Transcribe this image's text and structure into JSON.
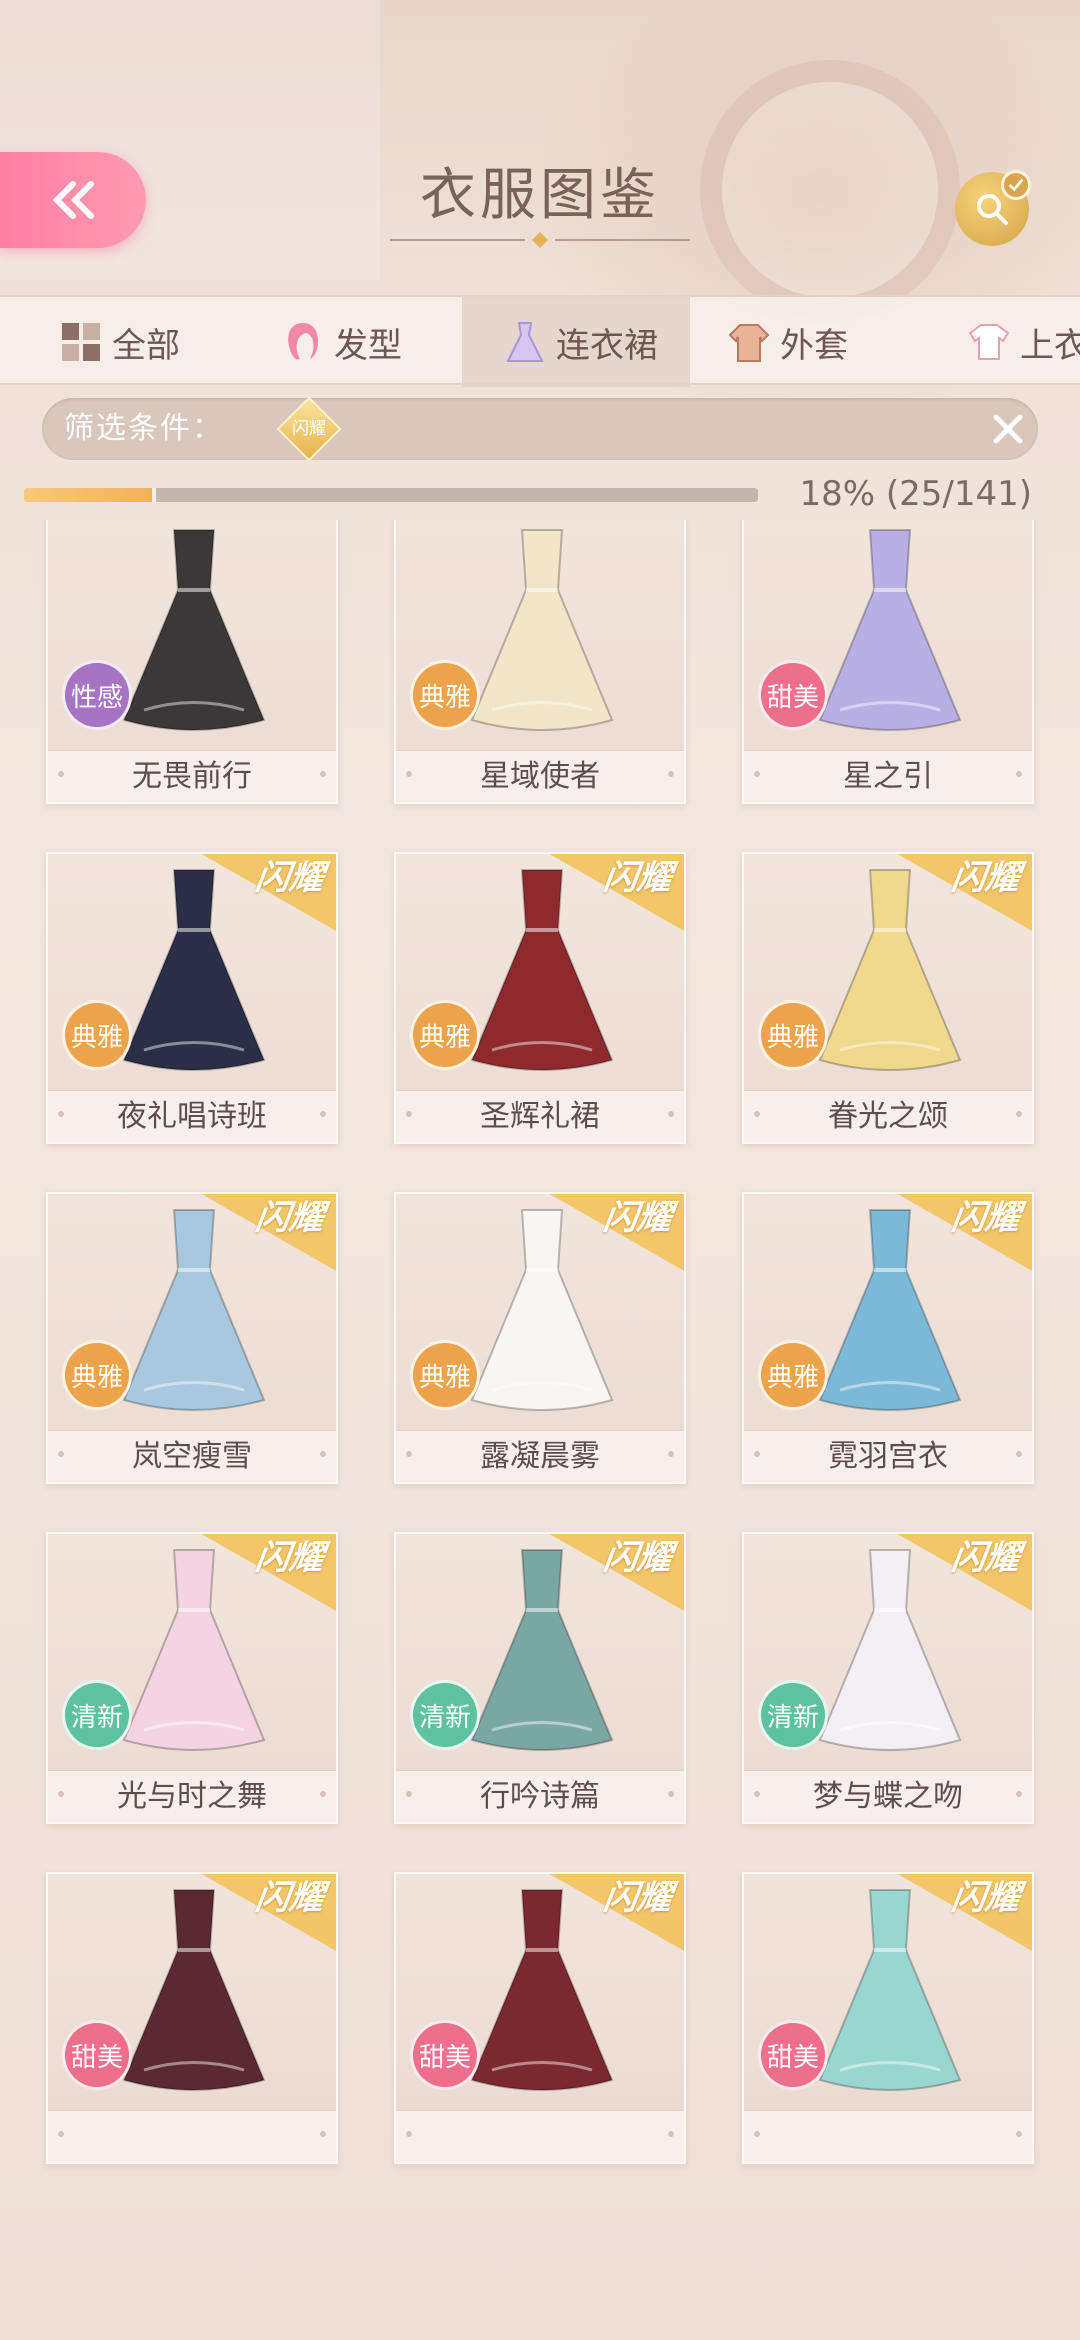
{
  "header": {
    "title": "衣服图鉴"
  },
  "tabs": [
    {
      "label": "全部",
      "icon": "grid-icon"
    },
    {
      "label": "发型",
      "icon": "hair-icon"
    },
    {
      "label": "连衣裙",
      "icon": "dress-icon",
      "active": true
    },
    {
      "label": "外套",
      "icon": "coat-icon"
    },
    {
      "label": "上衣",
      "icon": "shirt-icon"
    }
  ],
  "filter": {
    "label": "筛选条件：",
    "tag": "闪耀"
  },
  "progress": {
    "text": "18% (25/141)",
    "fraction": 0.18
  },
  "colors": {
    "sexy": "#a774c4",
    "elegant": "#eda24c",
    "sweet": "#ee6f8c",
    "fresh": "#5ec2a0",
    "ribbon": "#f2c25c"
  },
  "items": [
    {
      "name": "无畏前行",
      "badge": "性感",
      "ribbon": "",
      "dress_color": "#3a3838"
    },
    {
      "name": "星域使者",
      "badge": "典雅",
      "ribbon": "",
      "dress_color": "#f1e6c8"
    },
    {
      "name": "星之引",
      "badge": "甜美",
      "ribbon": "",
      "dress_color": "#b8b0e4"
    },
    {
      "name": "夜礼唱诗班",
      "badge": "典雅",
      "ribbon": "闪耀",
      "dress_color": "#2a2e46"
    },
    {
      "name": "圣辉礼裙",
      "badge": "典雅",
      "ribbon": "闪耀",
      "dress_color": "#8e2a2e"
    },
    {
      "name": "眷光之颂",
      "badge": "典雅",
      "ribbon": "闪耀",
      "dress_color": "#f0d88c"
    },
    {
      "name": "岚空瘦雪",
      "badge": "典雅",
      "ribbon": "闪耀",
      "dress_color": "#a8c8df"
    },
    {
      "name": "露凝晨雾",
      "badge": "典雅",
      "ribbon": "闪耀",
      "dress_color": "#f8f6f4"
    },
    {
      "name": "霓羽宫衣",
      "badge": "典雅",
      "ribbon": "闪耀",
      "dress_color": "#7cb8d8"
    },
    {
      "name": "光与时之舞",
      "badge": "清新",
      "ribbon": "闪耀",
      "dress_color": "#f4d4e2"
    },
    {
      "name": "行吟诗篇",
      "badge": "清新",
      "ribbon": "闪耀",
      "dress_color": "#7aa6a4"
    },
    {
      "name": "梦与蝶之吻",
      "badge": "清新",
      "ribbon": "闪耀",
      "dress_color": "#f2f0f4"
    },
    {
      "name": "",
      "badge": "甜美",
      "ribbon": "闪耀",
      "dress_color": "#5a2a30"
    },
    {
      "name": "",
      "badge": "甜美",
      "ribbon": "闪耀",
      "dress_color": "#7c2830"
    },
    {
      "name": "",
      "badge": "甜美",
      "ribbon": "闪耀",
      "dress_color": "#9ad6d0"
    }
  ]
}
